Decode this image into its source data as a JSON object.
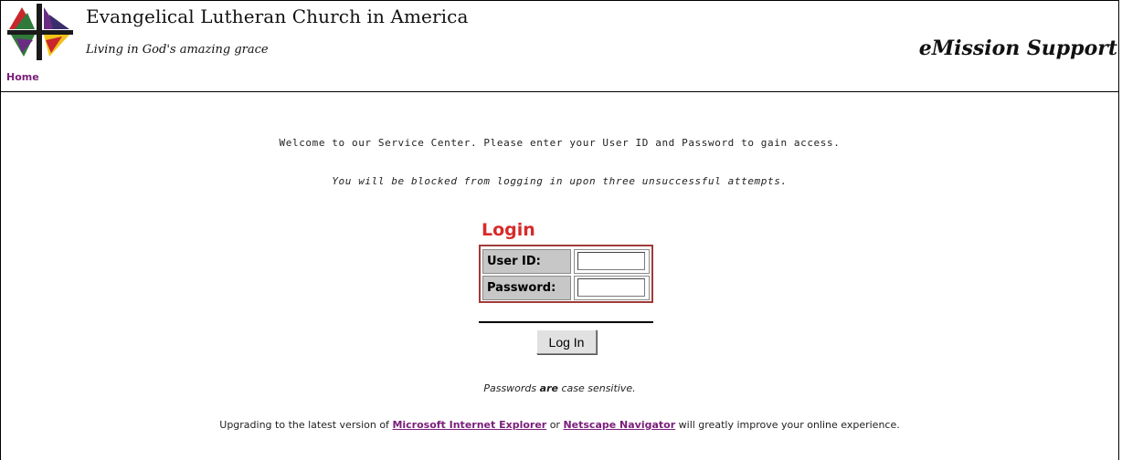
{
  "header": {
    "org_name": "Evangelical Lutheran Church in America",
    "tagline": "Living in God's amazing grace",
    "app_title": "eMission Support"
  },
  "nav": {
    "home_label": "Home"
  },
  "messages": {
    "welcome": "Welcome to our Service Center. Please enter your User ID and Password to gain access.",
    "warning": "You will be blocked from logging in upon three unsuccessful attempts."
  },
  "login": {
    "title": "Login",
    "user_id_label": "User ID:",
    "user_id_value": "",
    "password_label": "Password:",
    "password_value": "",
    "button_label": "Log In"
  },
  "case_note": {
    "prefix": "Passwords ",
    "emphasis": "are",
    "suffix": " case sensitive."
  },
  "upgrade": {
    "prefix": "Upgrading to the latest version of ",
    "ie_link": "Microsoft Internet Explorer",
    "middle": " or ",
    "netscape_link": "Netscape Navigator",
    "suffix": " will greatly improve your online experience."
  },
  "colors": {
    "accent_red": "#d62b2b",
    "link_purple": "#7a1e7a",
    "table_border": "#a23a3a"
  },
  "icons": {
    "logo": "elca-cross-logo-icon"
  }
}
